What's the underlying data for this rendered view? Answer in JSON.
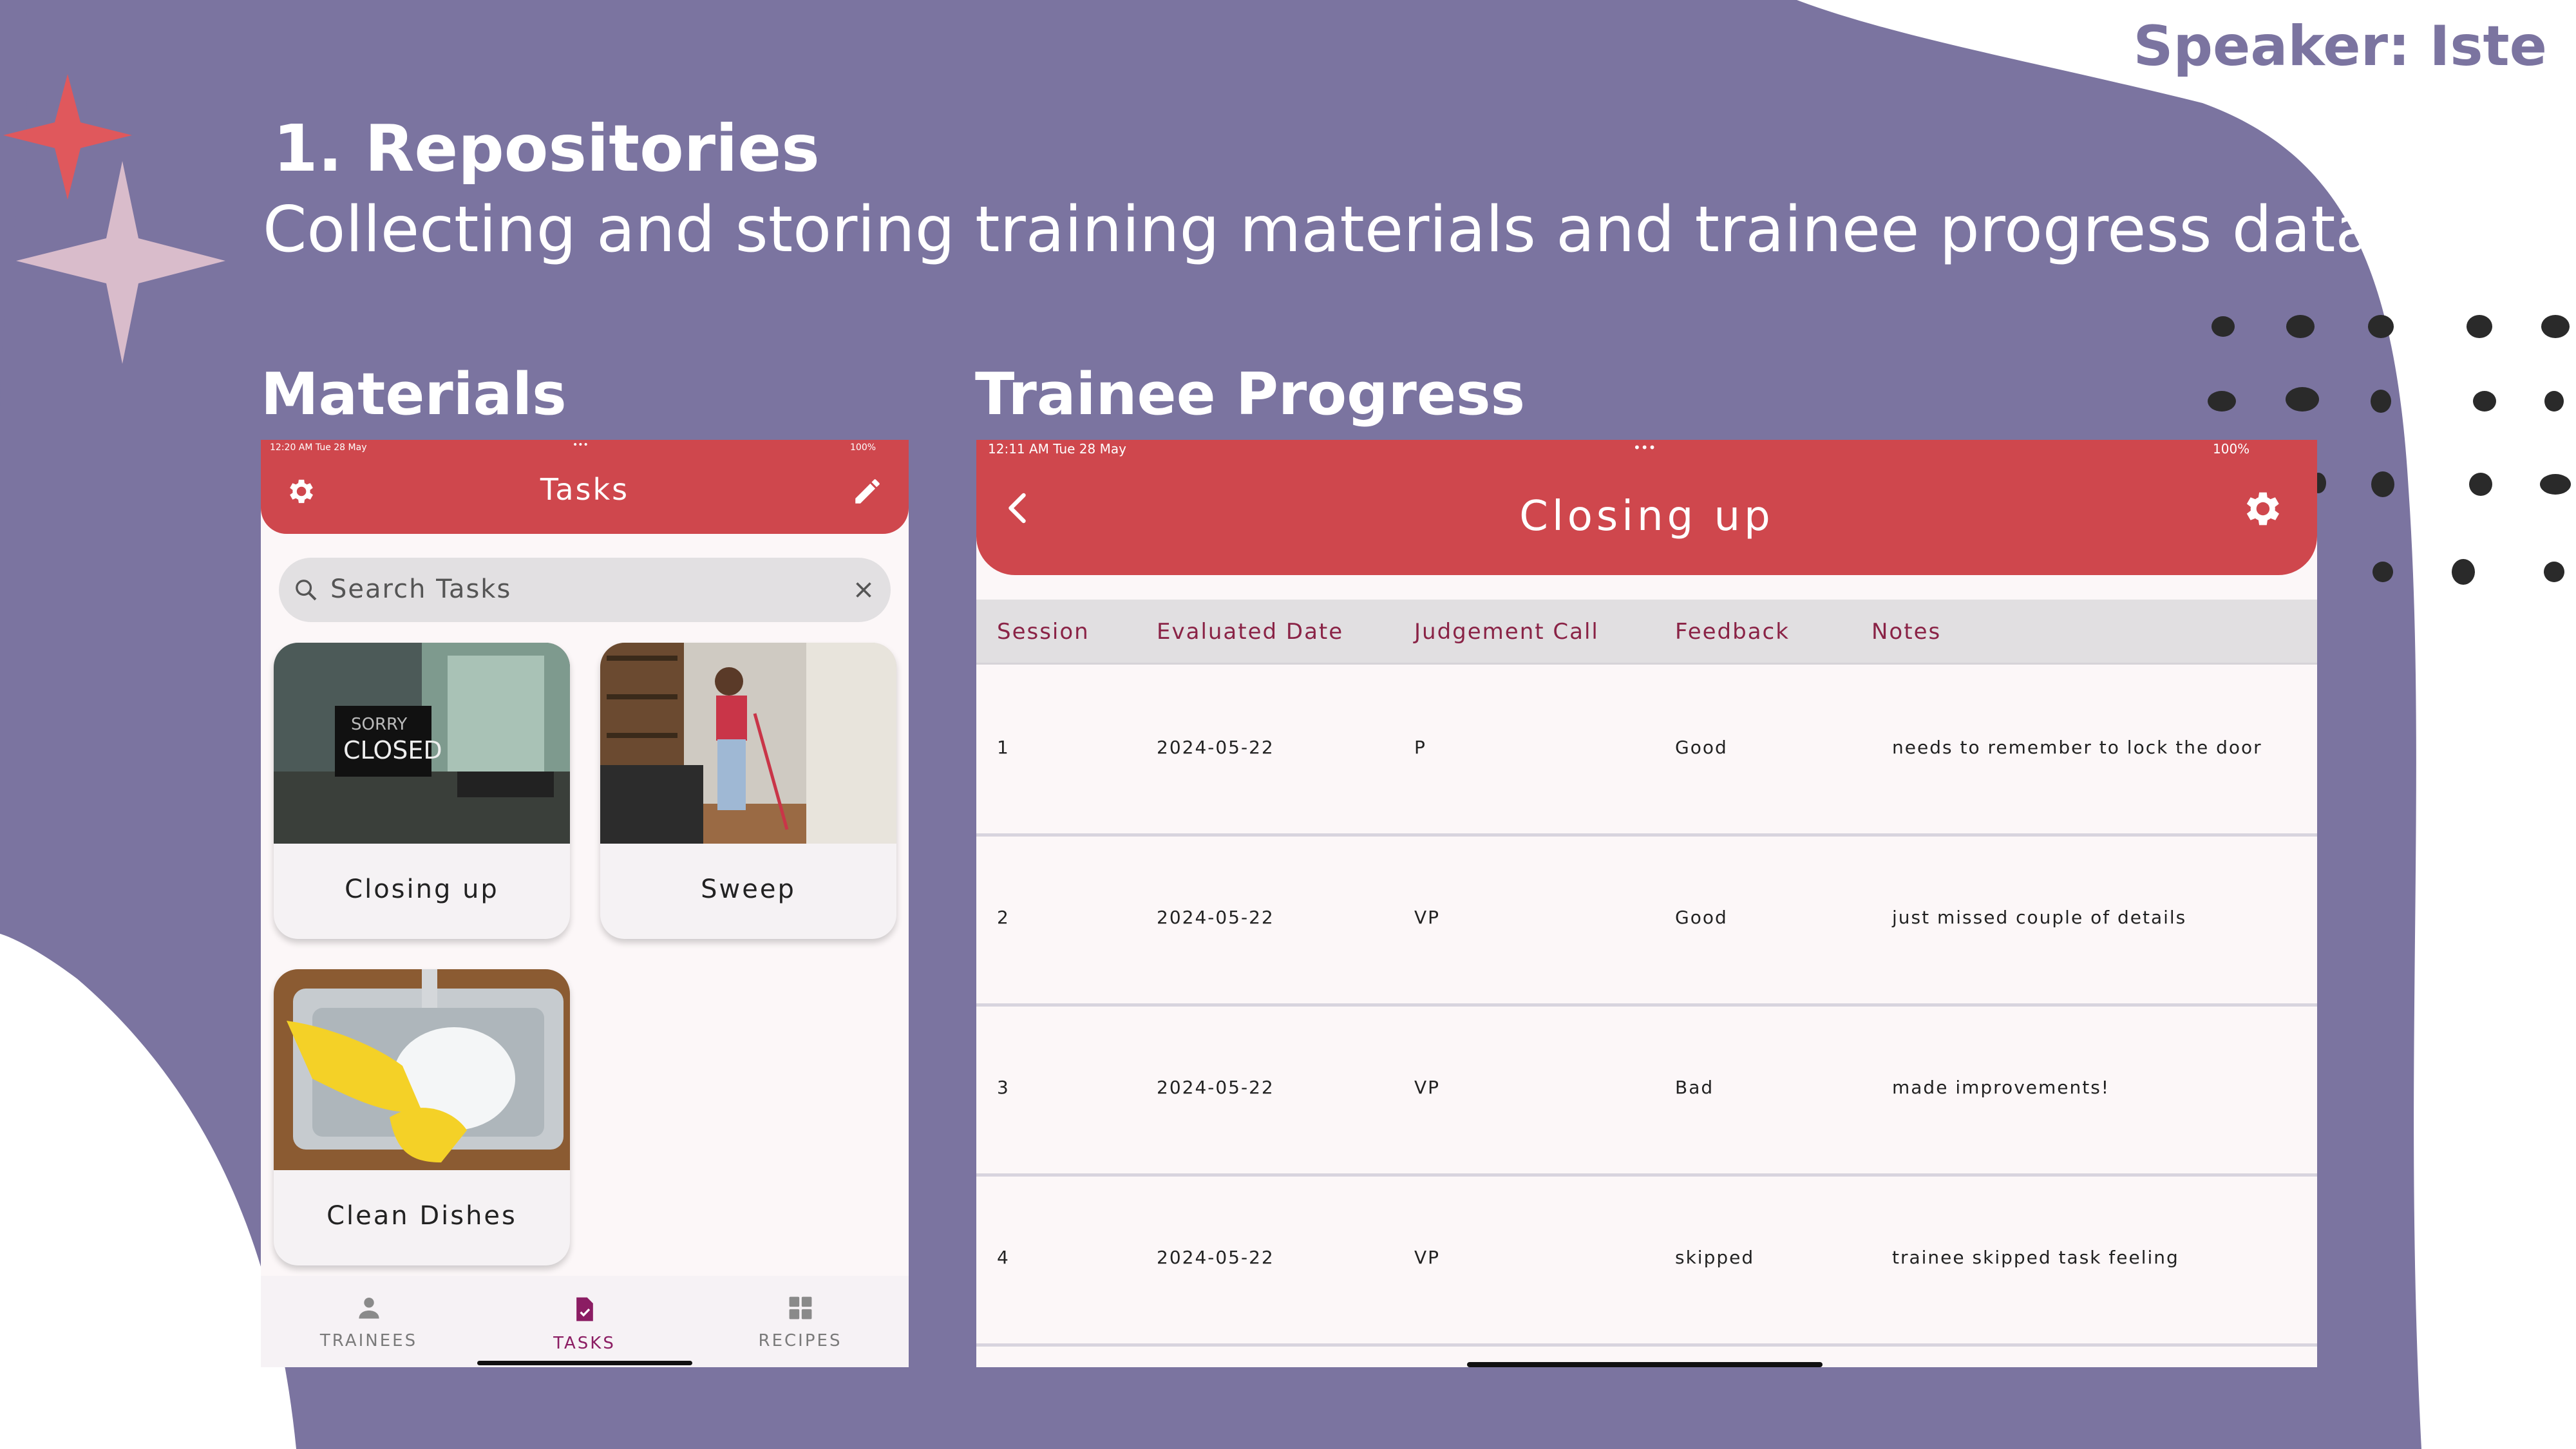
{
  "slide": {
    "speaker": "Speaker: Iste",
    "heading": "1. Repositories",
    "subtitle": "Collecting and storing training materials and trainee progress data",
    "materials_label": "Materials",
    "progress_label": "Trainee Progress"
  },
  "colors": {
    "background_shape": "#7b74a0",
    "app_bar": "#cf474d",
    "accent": "#8b1d63"
  },
  "tasks_app": {
    "status_time": "12:20 AM  Tue 28 May",
    "status_battery": "100%",
    "title": "Tasks",
    "search_placeholder": "Search Tasks",
    "cards": [
      {
        "label": "Closing up",
        "image_text_1": "SORRY",
        "image_text_2": "CLOSED"
      },
      {
        "label": "Sweep"
      },
      {
        "label": "Clean Dishes"
      }
    ],
    "nav": [
      {
        "label": "TRAINEES",
        "icon": "person-icon"
      },
      {
        "label": "TASKS",
        "icon": "task-icon"
      },
      {
        "label": "RECIPES",
        "icon": "grid-icon"
      }
    ]
  },
  "progress_app": {
    "status_time": "12:11 AM   Tue 28 May",
    "status_battery": "100%",
    "title": "Closing up",
    "columns": [
      "Session",
      "Evaluated Date",
      "Judgement Call",
      "Feedback",
      "Notes"
    ],
    "rows": [
      {
        "session": "1",
        "date": "2024-05-22",
        "judgement": "P",
        "feedback": "Good",
        "notes": "needs to remember to lock the door"
      },
      {
        "session": "2",
        "date": "2024-05-22",
        "judgement": "VP",
        "feedback": "Good",
        "notes": "just missed couple of details"
      },
      {
        "session": "3",
        "date": "2024-05-22",
        "judgement": "VP",
        "feedback": "Bad",
        "notes": "made improvements!"
      },
      {
        "session": "4",
        "date": "2024-05-22",
        "judgement": "VP",
        "feedback": "skipped",
        "notes": "trainee skipped task feeling"
      }
    ]
  }
}
